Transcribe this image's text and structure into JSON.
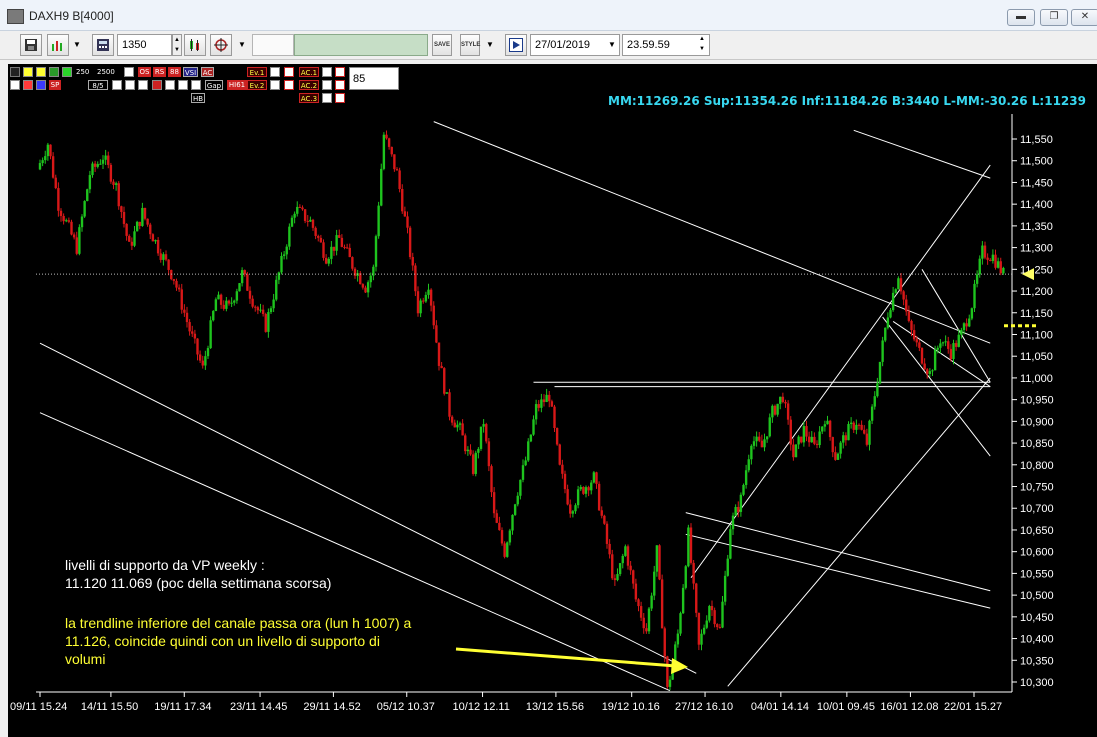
{
  "window": {
    "title": "DAXH9 B[4000]",
    "minimize_label": "▬",
    "restore_label": "❐",
    "close_label": "✕"
  },
  "toolbar": {
    "bars_value": "1350",
    "date_value": "27/01/2019",
    "time_value": "23.59.59",
    "save_label": "SAVE",
    "style_label": "STYLE"
  },
  "overlay": {
    "period_short": "250",
    "period_long": "2500",
    "btn_os": "OS",
    "btn_rs": "RS",
    "btn_88": "88",
    "btn_vsi": "VSI",
    "btn_ac": "AC",
    "btn_ev1": "Ev.1",
    "btn_ev2": "Ev.2",
    "btn_ac1": "AC.1",
    "btn_ac2": "AC.2",
    "btn_ac3": "AC.3",
    "btn_ratio": "8/5",
    "btn_gap": "Gap",
    "btn_hb": "HB",
    "btn_sp": "SP",
    "btn_hi61": "HI61",
    "input_value": "85"
  },
  "stats_text": "MM:11269.26 Sup:11354.26 Inf:11184.26 B:3440 L-MM:-30.26 L:11239",
  "annotation1": {
    "line1": "livelli di supporto da VP weekly :",
    "line2": "11.120   11.069 (poc della settimana scorsa)"
  },
  "annotation2": {
    "line1": "la trendline inferiore del canale passa ora (lun h 1007) a",
    "line2": "11.126, coincide quindi con un livello di supporto di",
    "line3": "volumi"
  },
  "chart_data": {
    "type": "candlestick",
    "symbol": "DAXH9",
    "ylim": [
      10270,
      11600
    ],
    "y_ticks": [
      11550,
      11500,
      11450,
      11400,
      11350,
      11300,
      11250,
      11200,
      11150,
      11100,
      11050,
      11000,
      10950,
      10900,
      10850,
      10800,
      10750,
      10700,
      10650,
      10600,
      10550,
      10500,
      10450,
      10400,
      10350,
      10300
    ],
    "y_tick_labels": [
      "11,550",
      "11,500",
      "11,450",
      "11,400",
      "11,350",
      "11,300",
      "11,250",
      "11,200",
      "11,150",
      "11,100",
      "11,050",
      "11,000",
      "10,950",
      "10,900",
      "10,850",
      "10,800",
      "10,750",
      "10,700",
      "10,650",
      "10,600",
      "10,550",
      "10,500",
      "10,450",
      "10,400",
      "10,350",
      "10,300"
    ],
    "x_tick_labels": [
      "09/11 15.24",
      "14/11 15.50",
      "19/11 17.34",
      "23/11 14.45",
      "29/11 14.52",
      "05/12 10.37",
      "10/12 12.11",
      "13/12 15.56",
      "19/12 10.16",
      "27/12 16.10",
      "04/01 14.14",
      "10/01 09.45",
      "16/01 12.08",
      "22/01 15.27"
    ],
    "last_price": 11239,
    "reference_level": 11239,
    "support_levels": [
      11120,
      11069
    ],
    "colors": {
      "up": "#1ec41e",
      "down": "#d81818",
      "trend": "#ffffff",
      "axis": "#ffffff",
      "stats": "#38d8f0",
      "annotation": "#ffff33",
      "background": "#000000"
    },
    "anchors": [
      [
        0,
        11480
      ],
      [
        4,
        11540
      ],
      [
        8,
        11400
      ],
      [
        15,
        11300
      ],
      [
        20,
        11470
      ],
      [
        25,
        11510
      ],
      [
        30,
        11440
      ],
      [
        35,
        11300
      ],
      [
        40,
        11380
      ],
      [
        46,
        11300
      ],
      [
        52,
        11230
      ],
      [
        58,
        11110
      ],
      [
        63,
        11020
      ],
      [
        68,
        11180
      ],
      [
        73,
        11160
      ],
      [
        78,
        11240
      ],
      [
        82,
        11180
      ],
      [
        87,
        11120
      ],
      [
        92,
        11240
      ],
      [
        98,
        11390
      ],
      [
        104,
        11360
      ],
      [
        110,
        11280
      ],
      [
        115,
        11320
      ],
      [
        120,
        11260
      ],
      [
        125,
        11210
      ],
      [
        128,
        11250
      ],
      [
        132,
        11560
      ],
      [
        137,
        11470
      ],
      [
        141,
        11330
      ],
      [
        145,
        11160
      ],
      [
        149,
        11220
      ],
      [
        153,
        11040
      ],
      [
        157,
        10920
      ],
      [
        161,
        10880
      ],
      [
        166,
        10790
      ],
      [
        170,
        10900
      ],
      [
        174,
        10680
      ],
      [
        178,
        10600
      ],
      [
        182,
        10720
      ],
      [
        186,
        10810
      ],
      [
        190,
        10930
      ],
      [
        195,
        10960
      ],
      [
        199,
        10790
      ],
      [
        203,
        10700
      ],
      [
        207,
        10740
      ],
      [
        212,
        10770
      ],
      [
        216,
        10650
      ],
      [
        220,
        10520
      ],
      [
        224,
        10610
      ],
      [
        228,
        10490
      ],
      [
        232,
        10420
      ],
      [
        236,
        10600
      ],
      [
        240,
        10280
      ],
      [
        244,
        10410
      ],
      [
        248,
        10640
      ],
      [
        252,
        10380
      ],
      [
        256,
        10480
      ],
      [
        260,
        10420
      ],
      [
        264,
        10660
      ],
      [
        268,
        10720
      ],
      [
        272,
        10860
      ],
      [
        276,
        10840
      ],
      [
        280,
        10920
      ],
      [
        284,
        10960
      ],
      [
        288,
        10820
      ],
      [
        292,
        10880
      ],
      [
        296,
        10840
      ],
      [
        300,
        10910
      ],
      [
        304,
        10820
      ],
      [
        308,
        10870
      ],
      [
        312,
        10900
      ],
      [
        316,
        10850
      ],
      [
        320,
        11000
      ],
      [
        324,
        11150
      ],
      [
        328,
        11240
      ],
      [
        332,
        11120
      ],
      [
        336,
        11060
      ],
      [
        340,
        11010
      ],
      [
        344,
        11090
      ],
      [
        348,
        11060
      ],
      [
        352,
        11100
      ],
      [
        356,
        11170
      ],
      [
        360,
        11290
      ],
      [
        364,
        11280
      ],
      [
        368,
        11239
      ]
    ],
    "trendlines": [
      {
        "from": [
          0,
          11080
        ],
        "to": [
          250,
          10320
        ]
      },
      {
        "from": [
          0,
          10920
        ],
        "to": [
          240,
          10280
        ]
      },
      {
        "from": [
          150,
          11590
        ],
        "to": [
          362,
          11080
        ]
      },
      {
        "from": [
          196,
          10980
        ],
        "to": [
          362,
          10980
        ]
      },
      {
        "from": [
          188,
          10990
        ],
        "to": [
          362,
          10990
        ]
      },
      {
        "from": [
          262,
          10290
        ],
        "to": [
          362,
          11000
        ]
      },
      {
        "from": [
          248,
          10540
        ],
        "to": [
          362,
          11490
        ]
      },
      {
        "from": [
          246,
          10690
        ],
        "to": [
          362,
          10510
        ]
      },
      {
        "from": [
          246,
          10640
        ],
        "to": [
          362,
          10470
        ]
      },
      {
        "from": [
          321,
          11140
        ],
        "to": [
          362,
          10820
        ]
      },
      {
        "from": [
          336,
          11250
        ],
        "to": [
          362,
          10990
        ]
      },
      {
        "from": [
          325,
          11130
        ],
        "to": [
          362,
          10980
        ]
      },
      {
        "from": [
          310,
          11570
        ],
        "to": [
          362,
          11460
        ]
      }
    ]
  }
}
